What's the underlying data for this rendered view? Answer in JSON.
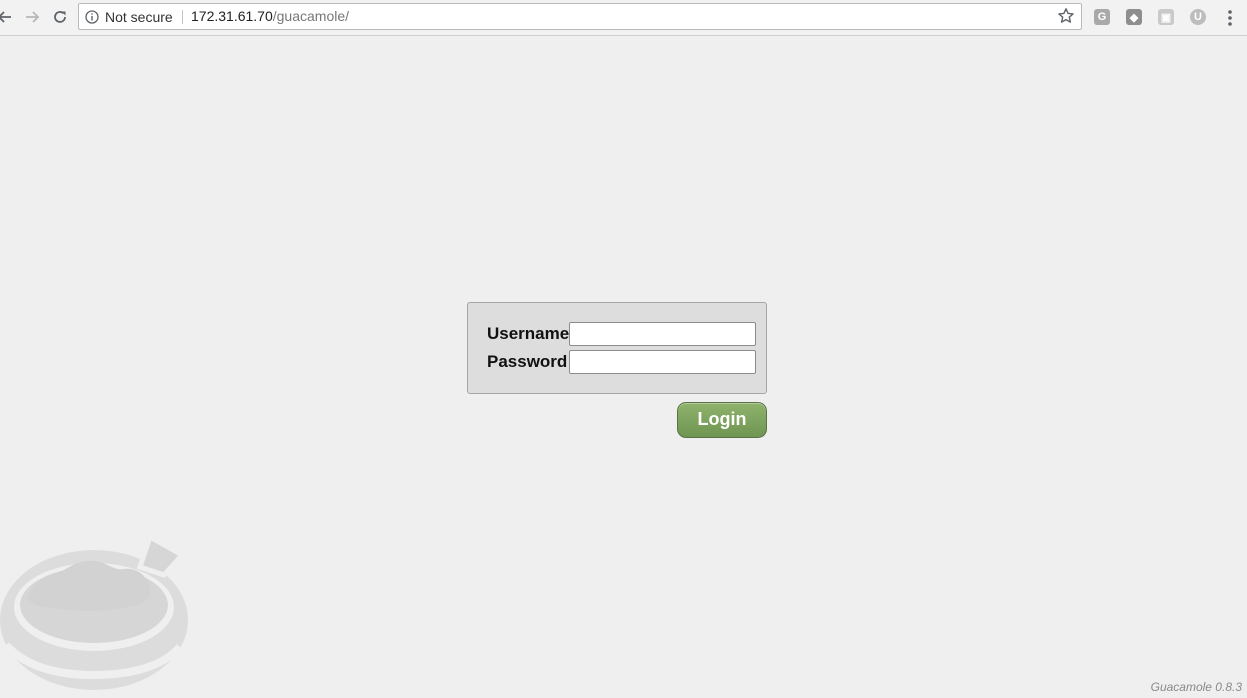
{
  "browser": {
    "security_label": "Not secure",
    "url_host": "172.31.61.70",
    "url_path": "/guacamole/",
    "icons": [
      "back-icon",
      "forward-icon",
      "reload-icon",
      "info-icon",
      "star-icon",
      "menu-icon"
    ],
    "extensions": [
      {
        "name": "extension-g-icon",
        "glyph": "G",
        "color": "#a9a9a9"
      },
      {
        "name": "extension-pocket-icon",
        "glyph": "◆",
        "color": "#8e8e8e"
      },
      {
        "name": "extension-camera-icon",
        "glyph": "▣",
        "color": "#c9c9c9"
      },
      {
        "name": "extension-u-icon",
        "glyph": "U",
        "color": "#bdbdbd"
      }
    ]
  },
  "login": {
    "username_label": "Username",
    "username_value": "",
    "password_label": "Password",
    "password_value": "",
    "button_label": "Login",
    "button_color": "#7ea35f"
  },
  "footer": {
    "version": "Guacamole 0.8.3"
  }
}
